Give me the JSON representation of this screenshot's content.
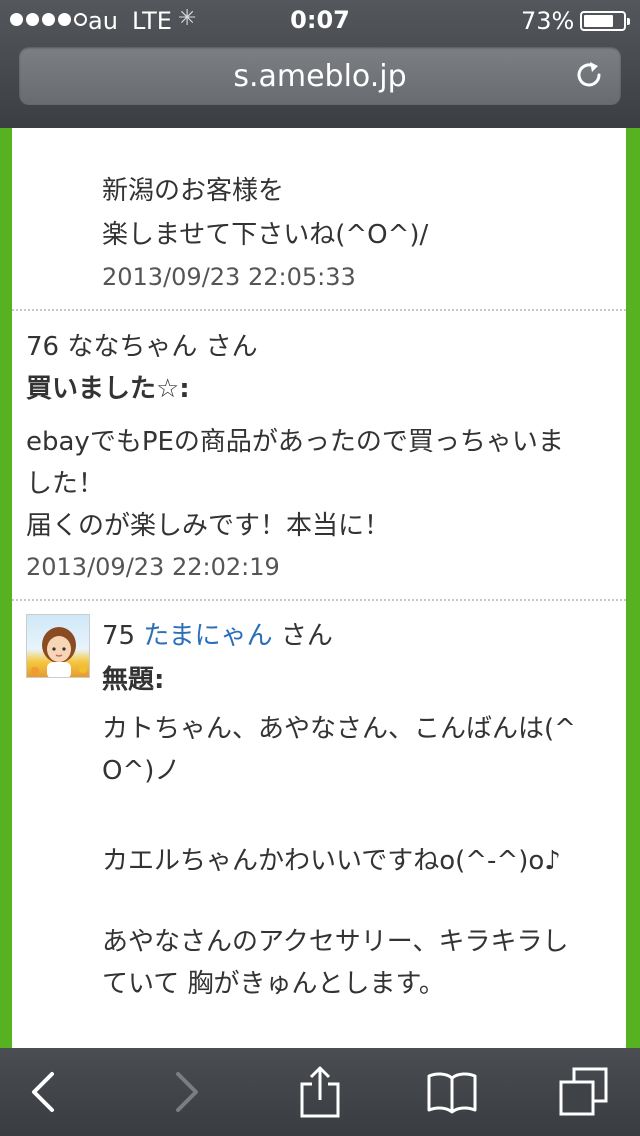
{
  "status": {
    "carrier": "au",
    "network": "LTE",
    "time": "0:07",
    "battery": "73%",
    "battery_level": 0.73
  },
  "browser": {
    "url": "s.ameblo.jp"
  },
  "comments": [
    {
      "body_lines": [
        "新潟のお客様を",
        "楽しませて下さいね(^O^)/"
      ],
      "date": "2013/09/23 22:05:33"
    },
    {
      "number": "76",
      "author": "ななちゃん",
      "honorific": "さん",
      "title": "買いました☆:",
      "body_lines": [
        "ebayでもPEの商品があったので買っちゃいま",
        "した！",
        "届くのが楽しみです！本当に！"
      ],
      "date": "2013/09/23 22:02:19"
    },
    {
      "number": "75",
      "author": "たまにゃん",
      "honorific": "さん",
      "title": "無題:",
      "body_lines": [
        "カトちゃん、あやなさん、こんばんは(^",
        "O^)ノ",
        "",
        "カエルちゃんかわいいですねo(^-^)o♪",
        "",
        "あやなさんのアクセサリー、キラキラし",
        "ていて 胸がきゅんとします。"
      ]
    }
  ],
  "icons": {
    "reload": "reload-icon",
    "back": "back-icon",
    "forward": "forward-icon",
    "share": "share-icon",
    "bookmarks": "bookmarks-icon",
    "tabs": "tabs-icon"
  },
  "colors": {
    "page_border": "#56b220",
    "link": "#2a6fb8"
  }
}
